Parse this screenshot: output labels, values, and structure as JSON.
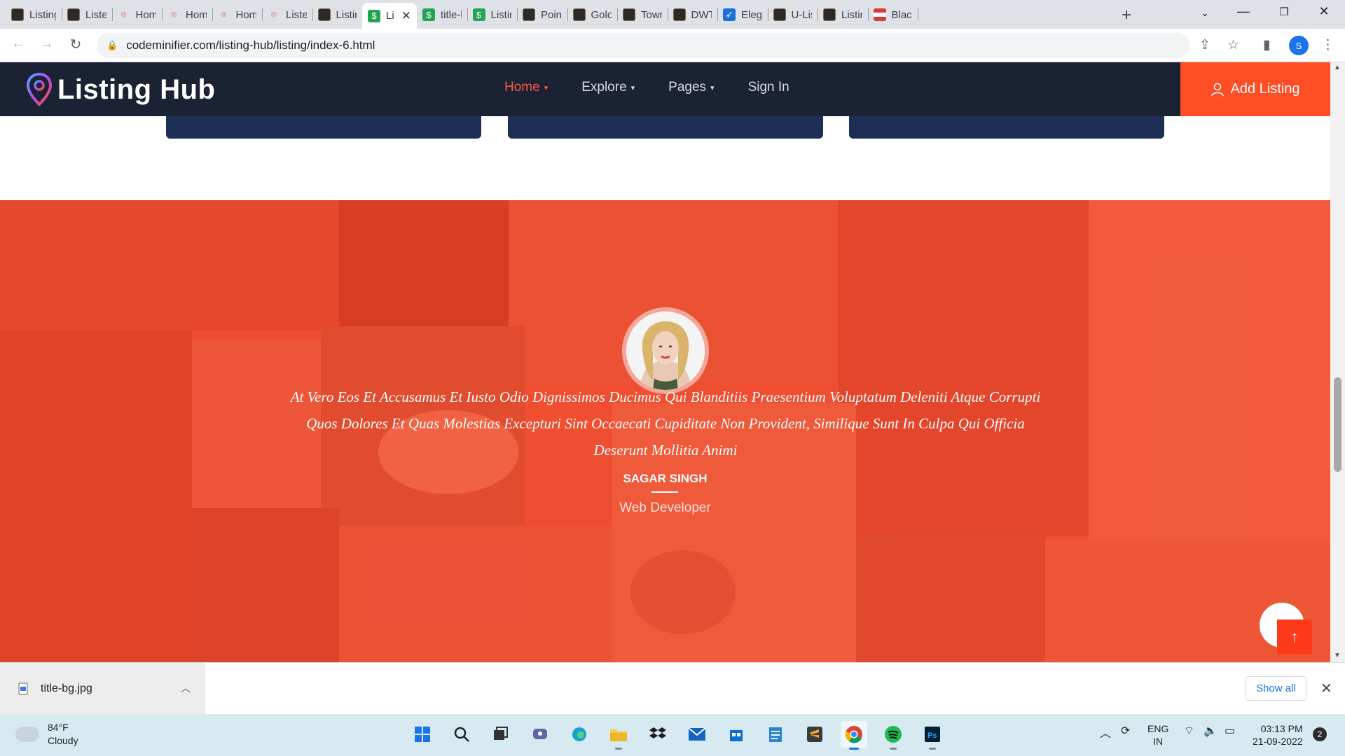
{
  "browser": {
    "tabs": [
      {
        "title": "Listing",
        "icon": "doc"
      },
      {
        "title": "Listed",
        "icon": "doc"
      },
      {
        "title": "Home",
        "icon": "pin"
      },
      {
        "title": "Home",
        "icon": "pin"
      },
      {
        "title": "Home",
        "icon": "pin"
      },
      {
        "title": "Listed",
        "icon": "pin"
      },
      {
        "title": "Listing",
        "icon": "doc"
      },
      {
        "title": "Li",
        "icon": "leaf",
        "active": true
      },
      {
        "title": "title-b",
        "icon": "leaf"
      },
      {
        "title": "Listing",
        "icon": "leaf"
      },
      {
        "title": "Pointi",
        "icon": "doc"
      },
      {
        "title": "Golo",
        "icon": "doc"
      },
      {
        "title": "Town",
        "icon": "doc"
      },
      {
        "title": "DWT",
        "icon": "doc"
      },
      {
        "title": "Elega",
        "icon": "blue"
      },
      {
        "title": "U-List",
        "icon": "doc"
      },
      {
        "title": "Listin",
        "icon": "doc"
      },
      {
        "title": "Black",
        "icon": "flag"
      }
    ],
    "url": "codeminifier.com/listing-hub/listing/index-6.html",
    "profile_initial": "S"
  },
  "site": {
    "logo_text": "Listing Hub",
    "nav": [
      {
        "label": "Home",
        "active": true
      },
      {
        "label": "Explore"
      },
      {
        "label": "Pages"
      },
      {
        "label": "Sign In"
      }
    ],
    "add_listing_label": "Add Listing",
    "accent_color": "#ff4e26",
    "header_color": "#1b2233"
  },
  "testimonial": {
    "quote": "At Vero Eos Et Accusamus Et Iusto Odio Dignissimos Ducimus Qui Blanditiis Praesentium Voluptatum Deleniti Atque Corrupti Quos Dolores Et Quas Molestias Excepturi Sint Occaecati Cupiditate Non Provident, Similique Sunt In Culpa Qui Officia Deserunt Mollitia Animi",
    "name": "SAGAR SINGH",
    "role": "Web Developer"
  },
  "download_bar": {
    "filename": "title-bg.jpg",
    "show_all_label": "Show all"
  },
  "taskbar": {
    "temperature": "84°F",
    "condition": "Cloudy",
    "language_line1": "ENG",
    "language_line2": "IN",
    "time": "03:13 PM",
    "date": "21-09-2022",
    "notification_count": "2"
  }
}
